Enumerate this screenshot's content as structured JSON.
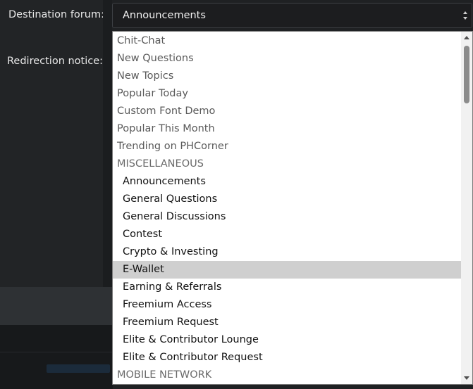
{
  "form": {
    "destination_label": "Destination forum:",
    "redirection_label": "Redirection notice:"
  },
  "select": {
    "value": "Announcements"
  },
  "dropdown": {
    "options": [
      {
        "label": "Chit-Chat",
        "kind": "top-level"
      },
      {
        "label": "New Questions",
        "kind": "top-level"
      },
      {
        "label": "New Topics",
        "kind": "top-level"
      },
      {
        "label": "Popular Today",
        "kind": "top-level"
      },
      {
        "label": "Custom Font Demo",
        "kind": "top-level"
      },
      {
        "label": "Popular This Month",
        "kind": "top-level"
      },
      {
        "label": "Trending on PHCorner",
        "kind": "top-level"
      },
      {
        "label": "MISCELLANEOUS",
        "kind": "group"
      },
      {
        "label": "Announcements",
        "kind": "child"
      },
      {
        "label": "General Questions",
        "kind": "child"
      },
      {
        "label": "General Discussions",
        "kind": "child"
      },
      {
        "label": "Contest",
        "kind": "child"
      },
      {
        "label": "Crypto & Investing",
        "kind": "child"
      },
      {
        "label": "E-Wallet",
        "kind": "child",
        "highlighted": true
      },
      {
        "label": "Earning & Referrals",
        "kind": "child"
      },
      {
        "label": "Freemium Access",
        "kind": "child"
      },
      {
        "label": "Freemium Request",
        "kind": "child"
      },
      {
        "label": "Elite & Contributor Lounge",
        "kind": "child"
      },
      {
        "label": "Elite & Contributor Request",
        "kind": "child"
      },
      {
        "label": "MOBILE NETWORK",
        "kind": "group"
      }
    ]
  },
  "scrollbar": {
    "position_fraction": 0.0
  }
}
